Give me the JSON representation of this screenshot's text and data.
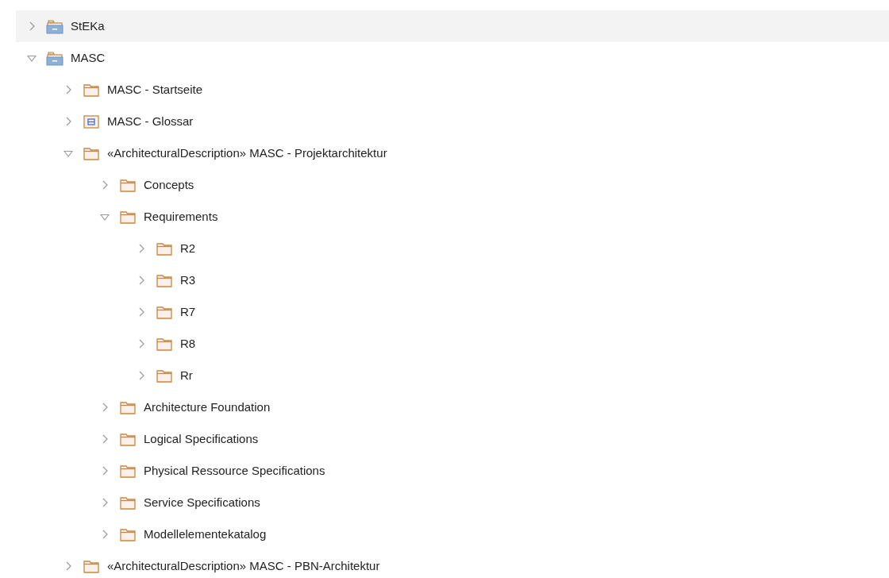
{
  "tree": [
    {
      "label": "StEKa",
      "kind": "package",
      "expanded": false,
      "selected": true
    },
    {
      "label": "MASC",
      "kind": "package",
      "expanded": true,
      "selected": false,
      "children": [
        {
          "label": "MASC - Startseite",
          "kind": "folder",
          "expanded": false,
          "selected": false
        },
        {
          "label": "MASC - Glossar",
          "kind": "glossary",
          "expanded": false,
          "selected": false
        },
        {
          "label": "«ArchitecturalDescription» MASC - Projektarchitektur",
          "kind": "folder",
          "expanded": true,
          "selected": false,
          "children": [
            {
              "label": "Concepts",
              "kind": "folder",
              "expanded": false,
              "selected": false
            },
            {
              "label": "Requirements",
              "kind": "folder",
              "expanded": true,
              "selected": false,
              "children": [
                {
                  "label": "R2",
                  "kind": "folder",
                  "expanded": false,
                  "selected": false
                },
                {
                  "label": "R3",
                  "kind": "folder",
                  "expanded": false,
                  "selected": false
                },
                {
                  "label": "R7",
                  "kind": "folder",
                  "expanded": false,
                  "selected": false
                },
                {
                  "label": "R8",
                  "kind": "folder",
                  "expanded": false,
                  "selected": false
                },
                {
                  "label": "Rr",
                  "kind": "folder",
                  "expanded": false,
                  "selected": false
                }
              ]
            },
            {
              "label": "Architecture Foundation",
              "kind": "folder",
              "expanded": false,
              "selected": false
            },
            {
              "label": "Logical Specifications",
              "kind": "folder",
              "expanded": false,
              "selected": false
            },
            {
              "label": "Physical Ressource Specifications",
              "kind": "folder",
              "expanded": false,
              "selected": false
            },
            {
              "label": "Service Specifications",
              "kind": "folder",
              "expanded": false,
              "selected": false
            },
            {
              "label": "Modellelementekatalog",
              "kind": "folder",
              "expanded": false,
              "selected": false
            }
          ]
        },
        {
          "label": "«ArchitecturalDescription» MASC - PBN-Architektur",
          "kind": "folder",
          "expanded": false,
          "selected": false
        }
      ]
    }
  ]
}
